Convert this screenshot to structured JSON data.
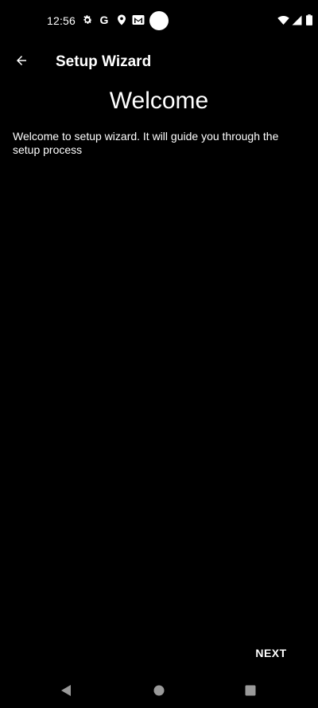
{
  "status_bar": {
    "time": "12:56",
    "icons": [
      "gear-icon",
      "google-icon",
      "location-icon",
      "gmail-icon",
      "camera-cutout"
    ],
    "right_icons": [
      "wifi-icon",
      "cell-signal-icon",
      "battery-icon"
    ],
    "google_letter": "G"
  },
  "app_bar": {
    "back_icon": "arrow-left-icon",
    "title": "Setup Wizard"
  },
  "content": {
    "heading": "Welcome",
    "body": "Welcome to setup wizard. It will guide you through the setup process"
  },
  "actions": {
    "next_label": "NEXT"
  },
  "nav_bar": {
    "icons": [
      "back-triangle-icon",
      "home-circle-icon",
      "recents-square-icon"
    ]
  },
  "colors": {
    "background": "#000000",
    "foreground": "#ffffff",
    "nav_icon": "#9a9a9a"
  }
}
